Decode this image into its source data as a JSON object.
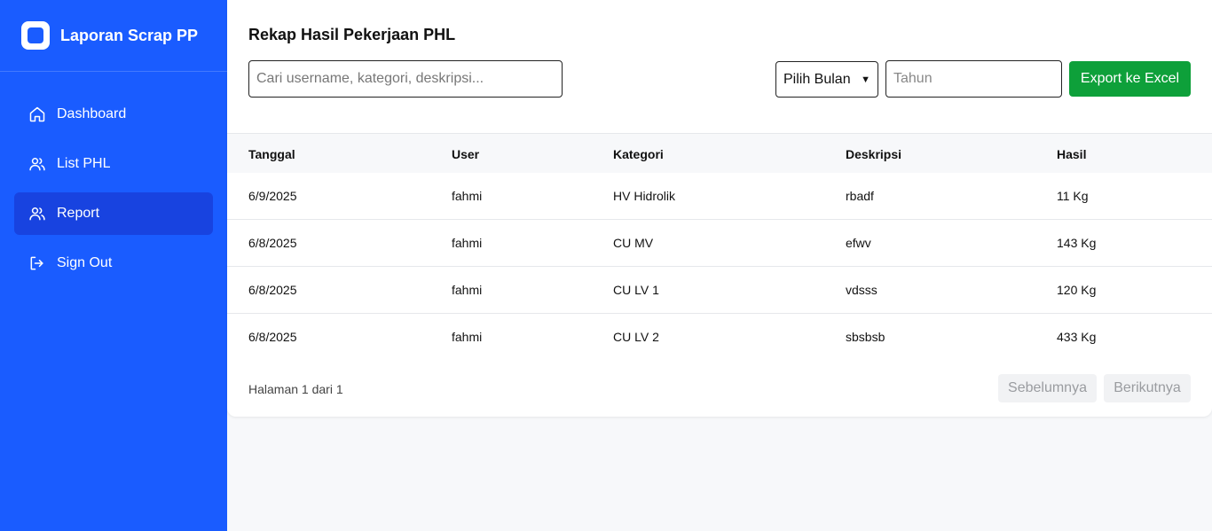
{
  "app": {
    "title": "Laporan Scrap PP"
  },
  "sidebar": {
    "items": [
      {
        "label": "Dashboard",
        "icon": "home-icon"
      },
      {
        "label": "List PHL",
        "icon": "users-icon"
      },
      {
        "label": "Report",
        "icon": "users-icon",
        "active": true
      },
      {
        "label": "Sign Out",
        "icon": "sign-out-icon"
      }
    ]
  },
  "main": {
    "title": "Rekap Hasil Pekerjaan PHL",
    "search_placeholder": "Cari username, kategori, deskripsi...",
    "month_select": "Pilih Bulan",
    "year_placeholder": "Tahun",
    "export_label": "Export ke Excel"
  },
  "table": {
    "headers": [
      "Tanggal",
      "User",
      "Kategori",
      "Deskripsi",
      "Hasil"
    ],
    "rows": [
      [
        "6/9/2025",
        "fahmi",
        "HV Hidrolik",
        "rbadf",
        "11 Kg"
      ],
      [
        "6/8/2025",
        "fahmi",
        "CU MV",
        "efwv",
        "143 Kg"
      ],
      [
        "6/8/2025",
        "fahmi",
        "CU LV 1",
        "vdsss",
        "120 Kg"
      ],
      [
        "6/8/2025",
        "fahmi",
        "CU LV 2",
        "sbsbsb",
        "433 Kg"
      ]
    ]
  },
  "pagination": {
    "info": "Halaman 1 dari 1",
    "prev_label": "Sebelumnya",
    "next_label": "Berikutnya"
  },
  "colors": {
    "sidebar": "#1a5cff",
    "active": "#1843e0",
    "export": "#0ea03a"
  }
}
